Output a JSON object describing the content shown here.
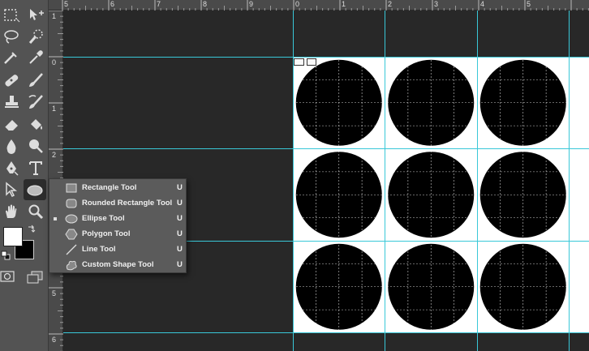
{
  "toolbox": {
    "tools": [
      {
        "name": "marquee-icon"
      },
      {
        "name": "move-icon"
      },
      {
        "name": "lasso-icon"
      },
      {
        "name": "quick-selection-icon"
      },
      {
        "name": "crop-icon"
      },
      {
        "name": "eyedropper-icon"
      },
      {
        "name": "healing-brush-icon"
      },
      {
        "name": "brush-icon"
      },
      {
        "name": "clone-stamp-icon"
      },
      {
        "name": "history-brush-icon"
      },
      {
        "name": "eraser-icon"
      },
      {
        "name": "paint-bucket-icon"
      },
      {
        "name": "blur-icon"
      },
      {
        "name": "dodge-icon"
      },
      {
        "name": "pen-icon"
      },
      {
        "name": "type-icon"
      },
      {
        "name": "path-selection-icon"
      },
      {
        "name": "ellipse-shape-icon"
      },
      {
        "name": "hand-icon"
      },
      {
        "name": "zoom-icon"
      }
    ],
    "foreground_color": "#ffffff",
    "background_color": "#000000"
  },
  "rulers": {
    "horizontal_labels": [
      "5",
      "6",
      "7",
      "8",
      "9",
      "0",
      "1",
      "2",
      "3",
      "4",
      "5"
    ],
    "vertical_labels": [
      "1",
      "0",
      "1",
      "2",
      "3",
      "4",
      "5",
      "6"
    ]
  },
  "guides": {
    "color": "#39c8d8"
  },
  "flyout": {
    "items": [
      {
        "label": "Rectangle Tool",
        "shortcut": "U",
        "selected": false,
        "icon": "rectangle-icon"
      },
      {
        "label": "Rounded Rectangle Tool",
        "shortcut": "U",
        "selected": false,
        "icon": "rounded-rectangle-icon"
      },
      {
        "label": "Ellipse Tool",
        "shortcut": "U",
        "selected": true,
        "icon": "ellipse-icon"
      },
      {
        "label": "Polygon Tool",
        "shortcut": "U",
        "selected": false,
        "icon": "polygon-icon"
      },
      {
        "label": "Line Tool",
        "shortcut": "U",
        "selected": false,
        "icon": "line-icon"
      },
      {
        "label": "Custom Shape Tool",
        "shortcut": "U",
        "selected": false,
        "icon": "custom-shape-icon"
      }
    ]
  },
  "document": {
    "background": "#ffffff",
    "circle_color": "#000000",
    "grid": {
      "rows": 3,
      "cols": 3
    }
  }
}
